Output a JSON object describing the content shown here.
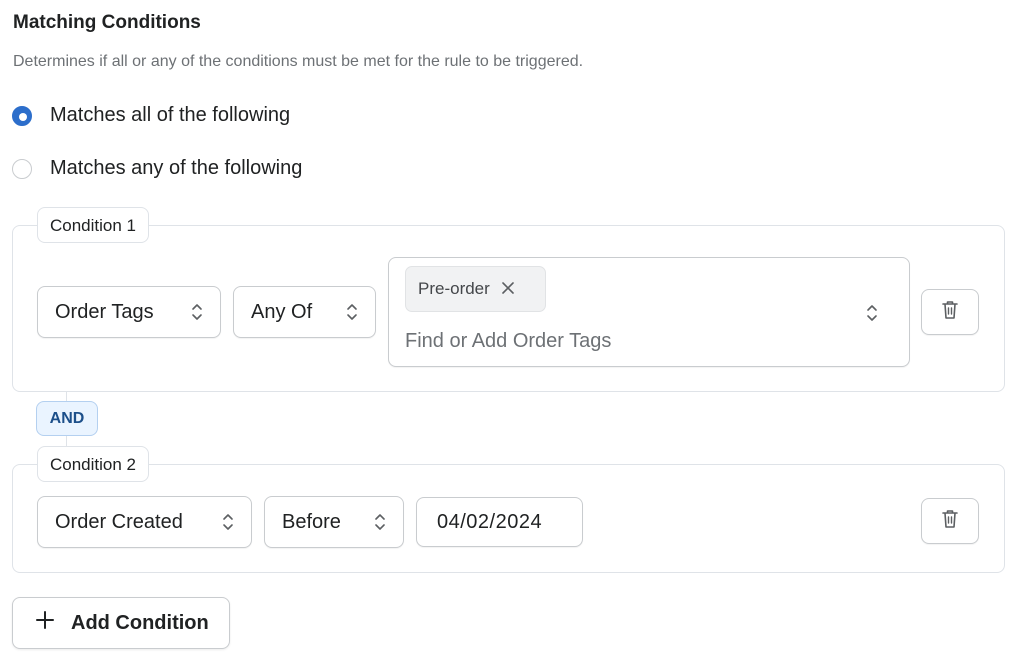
{
  "section": {
    "title": "Matching Conditions",
    "subtitle": "Determines if all or any of the conditions must be met for the rule to be triggered."
  },
  "match_mode": {
    "options": [
      {
        "label": "Matches all of the following",
        "checked": true
      },
      {
        "label": "Matches any of the following",
        "checked": false
      }
    ]
  },
  "conditions": [
    {
      "label": "Condition 1",
      "field": "Order Tags",
      "operator": "Any Of",
      "tags": [
        "Pre-order"
      ],
      "placeholder": "Find or Add Order Tags"
    },
    {
      "label": "Condition 2",
      "field": "Order Created",
      "operator": "Before",
      "value": "04/02/2024"
    }
  ],
  "connector": "AND",
  "add_button": {
    "label": "Add Condition"
  },
  "colors": {
    "accent": "#2c6ecb",
    "and_badge_bg": "#eaf4ff",
    "and_badge_text": "#1c4f8a"
  }
}
